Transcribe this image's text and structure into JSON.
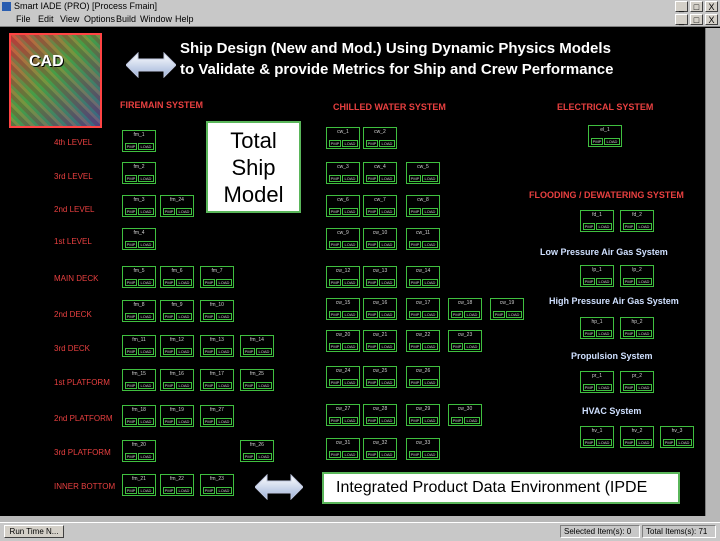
{
  "window": {
    "title": "Smart IADE (PRO)  [Process  Fmain]",
    "controls": [
      "_",
      "□",
      "X"
    ]
  },
  "menu": {
    "items": [
      "File",
      "Edit",
      "View",
      "Options",
      "Build",
      "Window",
      "Help"
    ],
    "controls": [
      "_",
      "□",
      "X"
    ]
  },
  "cad_label": "CAD",
  "headline": {
    "line1": "Ship Design (New and Mod.) Using Dynamic Physics Models",
    "line2": "to Validate & provide Metrics for Ship and Crew Performance"
  },
  "total_ship_model": {
    "line1": "Total",
    "line2": "Ship",
    "line3": "Model"
  },
  "ipde_label": "Integrated Product Data Environment (IPDE",
  "systems": {
    "firemain": "FIREMAIN SYSTEM",
    "chilled_water": "CHILLED WATER SYSTEM",
    "electrical": "ELECTRICAL SYSTEM",
    "flooding": "FLOODING / DEWATERING SYSTEM",
    "lp_air": "Low Pressure Air Gas System",
    "hp_air": "High Pressure Air Gas System",
    "propulsion": "Propulsion System",
    "hvac": "HVAC System"
  },
  "levels": [
    "4th LEVEL",
    "3rd LEVEL",
    "2nd LEVEL",
    "1st LEVEL",
    "MAIN DECK",
    "2nd DECK",
    "3rd DECK",
    "1st PLATFORM",
    "2nd PLATFORM",
    "3rd PLATFORM",
    "INNER BOTTOM"
  ],
  "node_btn1": "PMP",
  "node_btn2": "LOAD",
  "nodes": [
    "fm_1",
    "fm_2",
    "fm_3",
    "fm_4",
    "fm_5",
    "fm_6",
    "fm_7",
    "fm_8",
    "fm_9",
    "fm_10",
    "fm_11",
    "fm_12",
    "fm_13",
    "fm_14",
    "fm_15",
    "fm_16",
    "fm_17",
    "fm_18",
    "fm_19",
    "fm_20",
    "fm_21",
    "fm_22",
    "fm_23",
    "fm_24",
    "fm_25",
    "fm_26",
    "fm_27",
    "cw_1",
    "cw_2",
    "cw_3",
    "cw_4",
    "cw_5",
    "cw_6",
    "cw_7",
    "cw_8",
    "cw_9",
    "cw_10",
    "cw_11",
    "cw_12",
    "cw_13",
    "cw_14",
    "cw_15",
    "cw_16",
    "cw_17",
    "cw_18",
    "cw_19",
    "cw_20",
    "cw_21",
    "cw_22",
    "cw_23",
    "cw_24",
    "cw_25",
    "cw_26",
    "cw_27",
    "cw_28",
    "cw_29",
    "cw_30",
    "cw_31",
    "cw_32",
    "cw_33",
    "el_1",
    "fd_1",
    "fd_2",
    "lp_1",
    "lp_2",
    "hp_1",
    "hp_2",
    "pr_1",
    "pr_2",
    "hv_1",
    "hv_2",
    "hv_3"
  ],
  "taskbar": {
    "task": "Run  Time  N...",
    "status1": "Selected  Item(s):  0",
    "status2": "Total  Items(s):  71"
  },
  "colors": {
    "background": "#000000",
    "system_label": "#e84040",
    "node_border": "#3fbf3f",
    "callout_border": "#5ab65a"
  }
}
